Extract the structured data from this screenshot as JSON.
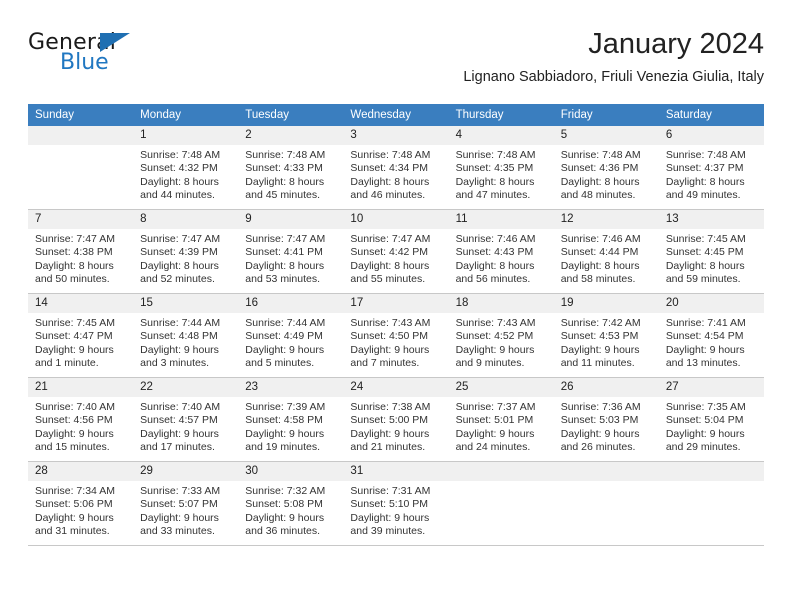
{
  "brand": {
    "line1": "General",
    "line2": "Blue",
    "triangle_color": "#1f6fb2",
    "blue_text_color": "#2077c1"
  },
  "header": {
    "title": "January 2024",
    "subtitle": "Lignano Sabbiadoro, Friuli Venezia Giulia, Italy"
  },
  "colors": {
    "header_row_bg": "#3a7ebf",
    "header_row_text": "#ffffff",
    "daynum_bg": "#f0f0f0",
    "cell_border": "#c8c8c8"
  },
  "weekdays": [
    "Sunday",
    "Monday",
    "Tuesday",
    "Wednesday",
    "Thursday",
    "Friday",
    "Saturday"
  ],
  "weeks": [
    [
      {
        "day": "",
        "lines": []
      },
      {
        "day": "1",
        "lines": [
          "Sunrise: 7:48 AM",
          "Sunset: 4:32 PM",
          "Daylight: 8 hours",
          "and 44 minutes."
        ]
      },
      {
        "day": "2",
        "lines": [
          "Sunrise: 7:48 AM",
          "Sunset: 4:33 PM",
          "Daylight: 8 hours",
          "and 45 minutes."
        ]
      },
      {
        "day": "3",
        "lines": [
          "Sunrise: 7:48 AM",
          "Sunset: 4:34 PM",
          "Daylight: 8 hours",
          "and 46 minutes."
        ]
      },
      {
        "day": "4",
        "lines": [
          "Sunrise: 7:48 AM",
          "Sunset: 4:35 PM",
          "Daylight: 8 hours",
          "and 47 minutes."
        ]
      },
      {
        "day": "5",
        "lines": [
          "Sunrise: 7:48 AM",
          "Sunset: 4:36 PM",
          "Daylight: 8 hours",
          "and 48 minutes."
        ]
      },
      {
        "day": "6",
        "lines": [
          "Sunrise: 7:48 AM",
          "Sunset: 4:37 PM",
          "Daylight: 8 hours",
          "and 49 minutes."
        ]
      }
    ],
    [
      {
        "day": "7",
        "lines": [
          "Sunrise: 7:47 AM",
          "Sunset: 4:38 PM",
          "Daylight: 8 hours",
          "and 50 minutes."
        ]
      },
      {
        "day": "8",
        "lines": [
          "Sunrise: 7:47 AM",
          "Sunset: 4:39 PM",
          "Daylight: 8 hours",
          "and 52 minutes."
        ]
      },
      {
        "day": "9",
        "lines": [
          "Sunrise: 7:47 AM",
          "Sunset: 4:41 PM",
          "Daylight: 8 hours",
          "and 53 minutes."
        ]
      },
      {
        "day": "10",
        "lines": [
          "Sunrise: 7:47 AM",
          "Sunset: 4:42 PM",
          "Daylight: 8 hours",
          "and 55 minutes."
        ]
      },
      {
        "day": "11",
        "lines": [
          "Sunrise: 7:46 AM",
          "Sunset: 4:43 PM",
          "Daylight: 8 hours",
          "and 56 minutes."
        ]
      },
      {
        "day": "12",
        "lines": [
          "Sunrise: 7:46 AM",
          "Sunset: 4:44 PM",
          "Daylight: 8 hours",
          "and 58 minutes."
        ]
      },
      {
        "day": "13",
        "lines": [
          "Sunrise: 7:45 AM",
          "Sunset: 4:45 PM",
          "Daylight: 8 hours",
          "and 59 minutes."
        ]
      }
    ],
    [
      {
        "day": "14",
        "lines": [
          "Sunrise: 7:45 AM",
          "Sunset: 4:47 PM",
          "Daylight: 9 hours",
          "and 1 minute."
        ]
      },
      {
        "day": "15",
        "lines": [
          "Sunrise: 7:44 AM",
          "Sunset: 4:48 PM",
          "Daylight: 9 hours",
          "and 3 minutes."
        ]
      },
      {
        "day": "16",
        "lines": [
          "Sunrise: 7:44 AM",
          "Sunset: 4:49 PM",
          "Daylight: 9 hours",
          "and 5 minutes."
        ]
      },
      {
        "day": "17",
        "lines": [
          "Sunrise: 7:43 AM",
          "Sunset: 4:50 PM",
          "Daylight: 9 hours",
          "and 7 minutes."
        ]
      },
      {
        "day": "18",
        "lines": [
          "Sunrise: 7:43 AM",
          "Sunset: 4:52 PM",
          "Daylight: 9 hours",
          "and 9 minutes."
        ]
      },
      {
        "day": "19",
        "lines": [
          "Sunrise: 7:42 AM",
          "Sunset: 4:53 PM",
          "Daylight: 9 hours",
          "and 11 minutes."
        ]
      },
      {
        "day": "20",
        "lines": [
          "Sunrise: 7:41 AM",
          "Sunset: 4:54 PM",
          "Daylight: 9 hours",
          "and 13 minutes."
        ]
      }
    ],
    [
      {
        "day": "21",
        "lines": [
          "Sunrise: 7:40 AM",
          "Sunset: 4:56 PM",
          "Daylight: 9 hours",
          "and 15 minutes."
        ]
      },
      {
        "day": "22",
        "lines": [
          "Sunrise: 7:40 AM",
          "Sunset: 4:57 PM",
          "Daylight: 9 hours",
          "and 17 minutes."
        ]
      },
      {
        "day": "23",
        "lines": [
          "Sunrise: 7:39 AM",
          "Sunset: 4:58 PM",
          "Daylight: 9 hours",
          "and 19 minutes."
        ]
      },
      {
        "day": "24",
        "lines": [
          "Sunrise: 7:38 AM",
          "Sunset: 5:00 PM",
          "Daylight: 9 hours",
          "and 21 minutes."
        ]
      },
      {
        "day": "25",
        "lines": [
          "Sunrise: 7:37 AM",
          "Sunset: 5:01 PM",
          "Daylight: 9 hours",
          "and 24 minutes."
        ]
      },
      {
        "day": "26",
        "lines": [
          "Sunrise: 7:36 AM",
          "Sunset: 5:03 PM",
          "Daylight: 9 hours",
          "and 26 minutes."
        ]
      },
      {
        "day": "27",
        "lines": [
          "Sunrise: 7:35 AM",
          "Sunset: 5:04 PM",
          "Daylight: 9 hours",
          "and 29 minutes."
        ]
      }
    ],
    [
      {
        "day": "28",
        "lines": [
          "Sunrise: 7:34 AM",
          "Sunset: 5:06 PM",
          "Daylight: 9 hours",
          "and 31 minutes."
        ]
      },
      {
        "day": "29",
        "lines": [
          "Sunrise: 7:33 AM",
          "Sunset: 5:07 PM",
          "Daylight: 9 hours",
          "and 33 minutes."
        ]
      },
      {
        "day": "30",
        "lines": [
          "Sunrise: 7:32 AM",
          "Sunset: 5:08 PM",
          "Daylight: 9 hours",
          "and 36 minutes."
        ]
      },
      {
        "day": "31",
        "lines": [
          "Sunrise: 7:31 AM",
          "Sunset: 5:10 PM",
          "Daylight: 9 hours",
          "and 39 minutes."
        ]
      },
      {
        "day": "",
        "lines": []
      },
      {
        "day": "",
        "lines": []
      },
      {
        "day": "",
        "lines": []
      }
    ]
  ]
}
